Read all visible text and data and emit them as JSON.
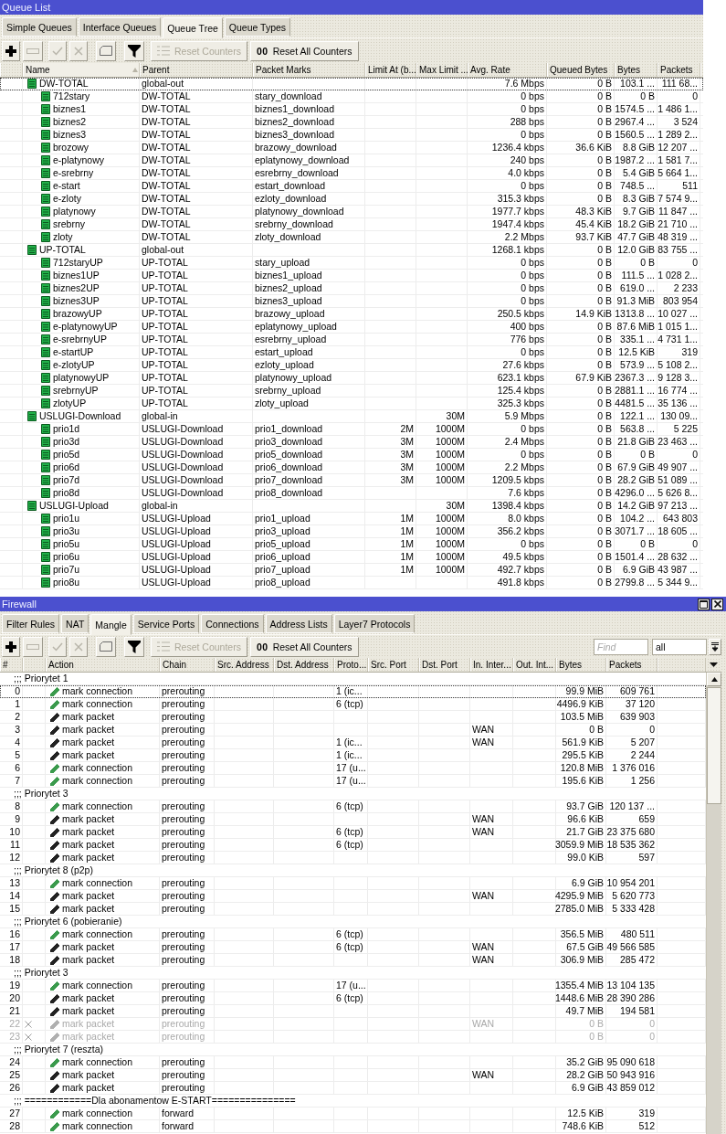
{
  "queue_list": {
    "title": "Queue List",
    "tabs": [
      {
        "label": "Simple Queues",
        "selected": false
      },
      {
        "label": "Interface Queues",
        "selected": false
      },
      {
        "label": "Queue Tree",
        "selected": true
      },
      {
        "label": "Queue Types",
        "selected": false
      }
    ],
    "toolbar": [
      {
        "kind": "add",
        "disabled": false
      },
      {
        "kind": "remove",
        "disabled": true
      },
      {
        "kind": "enable",
        "disabled": true
      },
      {
        "kind": "disable",
        "disabled": true
      },
      {
        "kind": "comment",
        "disabled": false
      },
      {
        "kind": "filter",
        "disabled": false
      },
      {
        "kind": "reset",
        "label": "Reset Counters",
        "disabled": true
      },
      {
        "kind": "reset_all",
        "glyph": "00",
        "label": "Reset All Counters",
        "disabled": false
      }
    ],
    "table": {
      "columns": [
        {
          "label": "Name",
          "sorted": true
        },
        {
          "label": "Parent",
          "sorted": false
        },
        {
          "label": "Packet Marks",
          "sorted": false
        },
        {
          "label": "Limit At (b...",
          "sorted": false
        },
        {
          "label": "Max Limit ...",
          "sorted": false
        },
        {
          "label": "Avg. Rate",
          "sorted": false
        },
        {
          "label": "Queued Bytes",
          "sorted": false
        },
        {
          "label": "Bytes",
          "sorted": false
        },
        {
          "label": "Packets",
          "sorted": false
        }
      ],
      "rows": [
        {
          "name": "DW-TOTAL",
          "parent": "global-out",
          "avg_rate": "7.6 Mbps",
          "queued_bytes": "0 B",
          "bytes": "103.1 ...",
          "packets": "111 68...",
          "selected": true,
          "children": [
            {
              "name": "712stary",
              "parent": "DW-TOTAL",
              "packet_marks": "stary_download",
              "avg_rate": "0 bps",
              "queued_bytes": "0 B",
              "bytes": "0 B",
              "packets": "0",
              "selected": false
            },
            {
              "name": "biznes1",
              "parent": "DW-TOTAL",
              "packet_marks": "biznes1_download",
              "avg_rate": "0 bps",
              "queued_bytes": "0 B",
              "bytes": "1574.5 ...",
              "packets": "1 486 1...",
              "selected": false
            },
            {
              "name": "biznes2",
              "parent": "DW-TOTAL",
              "packet_marks": "biznes2_download",
              "avg_rate": "288 bps",
              "queued_bytes": "0 B",
              "bytes": "2967.4 ...",
              "packets": "3 524",
              "selected": false
            },
            {
              "name": "biznes3",
              "parent": "DW-TOTAL",
              "packet_marks": "biznes3_download",
              "avg_rate": "0 bps",
              "queued_bytes": "0 B",
              "bytes": "1560.5 ...",
              "packets": "1 289 2...",
              "selected": false
            },
            {
              "name": "brozowy",
              "parent": "DW-TOTAL",
              "packet_marks": "brazowy_download",
              "avg_rate": "1236.4 kbps",
              "queued_bytes": "36.6 KiB",
              "bytes": "8.8 GiB",
              "packets": "12 207 ...",
              "selected": false
            },
            {
              "name": "e-platynowy",
              "parent": "DW-TOTAL",
              "packet_marks": "eplatynowy_download",
              "avg_rate": "240 bps",
              "queued_bytes": "0 B",
              "bytes": "1987.2 ...",
              "packets": "1 581 7...",
              "selected": false
            },
            {
              "name": "e-srebrny",
              "parent": "DW-TOTAL",
              "packet_marks": "esrebrny_download",
              "avg_rate": "4.0 kbps",
              "queued_bytes": "0 B",
              "bytes": "5.4 GiB",
              "packets": "5 664 1...",
              "selected": false
            },
            {
              "name": "e-start",
              "parent": "DW-TOTAL",
              "packet_marks": "estart_download",
              "avg_rate": "0 bps",
              "queued_bytes": "0 B",
              "bytes": "748.5 ...",
              "packets": "511",
              "selected": false
            },
            {
              "name": "e-zloty",
              "parent": "DW-TOTAL",
              "packet_marks": "ezloty_download",
              "avg_rate": "315.3 kbps",
              "queued_bytes": "0 B",
              "bytes": "8.3 GiB",
              "packets": "7 574 9...",
              "selected": false
            },
            {
              "name": "platynowy",
              "parent": "DW-TOTAL",
              "packet_marks": "platynowy_download",
              "avg_rate": "1977.7 kbps",
              "queued_bytes": "48.3 KiB",
              "bytes": "9.7 GiB",
              "packets": "11 847 ...",
              "selected": false
            },
            {
              "name": "srebrny",
              "parent": "DW-TOTAL",
              "packet_marks": "srebrny_download",
              "avg_rate": "1947.4 kbps",
              "queued_bytes": "45.4 KiB",
              "bytes": "18.2 GiB",
              "packets": "21 710 ...",
              "selected": false
            },
            {
              "name": "zloty",
              "parent": "DW-TOTAL",
              "packet_marks": "zloty_download",
              "avg_rate": "2.2 Mbps",
              "queued_bytes": "93.7 KiB",
              "bytes": "47.7 GiB",
              "packets": "48 319 ...",
              "selected": false
            }
          ]
        },
        {
          "name": "UP-TOTAL",
          "parent": "global-out",
          "avg_rate": "1268.1 kbps",
          "queued_bytes": "0 B",
          "bytes": "12.0 GiB",
          "packets": "83 755 ...",
          "selected": false,
          "children": [
            {
              "name": "712staryUP",
              "parent": "UP-TOTAL",
              "packet_marks": "stary_upload",
              "avg_rate": "0 bps",
              "queued_bytes": "0 B",
              "bytes": "0 B",
              "packets": "0",
              "selected": false
            },
            {
              "name": "biznes1UP",
              "parent": "UP-TOTAL",
              "packet_marks": "biznes1_upload",
              "avg_rate": "0 bps",
              "queued_bytes": "0 B",
              "bytes": "111.5 ...",
              "packets": "1 028 2...",
              "selected": false
            },
            {
              "name": "biznes2UP",
              "parent": "UP-TOTAL",
              "packet_marks": "biznes2_upload",
              "avg_rate": "0 bps",
              "queued_bytes": "0 B",
              "bytes": "619.0 ...",
              "packets": "2 233",
              "selected": false
            },
            {
              "name": "biznes3UP",
              "parent": "UP-TOTAL",
              "packet_marks": "biznes3_upload",
              "avg_rate": "0 bps",
              "queued_bytes": "0 B",
              "bytes": "91.3 MiB",
              "packets": "803 954",
              "selected": false
            },
            {
              "name": "brazowyUP",
              "parent": "UP-TOTAL",
              "packet_marks": "brazowy_upload",
              "avg_rate": "250.5 kbps",
              "queued_bytes": "14.9 KiB",
              "bytes": "1313.8 ...",
              "packets": "10 027 ...",
              "selected": false
            },
            {
              "name": "e-platynowyUP",
              "parent": "UP-TOTAL",
              "packet_marks": "eplatynowy_upload",
              "avg_rate": "400 bps",
              "queued_bytes": "0 B",
              "bytes": "87.6 MiB",
              "packets": "1 015 1...",
              "selected": false
            },
            {
              "name": "e-srebrnyUP",
              "parent": "UP-TOTAL",
              "packet_marks": "esrebrny_upload",
              "avg_rate": "776 bps",
              "queued_bytes": "0 B",
              "bytes": "335.1 ...",
              "packets": "4 731 1...",
              "selected": false
            },
            {
              "name": "e-startUP",
              "parent": "UP-TOTAL",
              "packet_marks": "estart_upload",
              "avg_rate": "0 bps",
              "queued_bytes": "0 B",
              "bytes": "12.5 KiB",
              "packets": "319",
              "selected": false
            },
            {
              "name": "e-zlotyUP",
              "parent": "UP-TOTAL",
              "packet_marks": "ezloty_upload",
              "avg_rate": "27.6 kbps",
              "queued_bytes": "0 B",
              "bytes": "573.9 ...",
              "packets": "5 108 2...",
              "selected": false
            },
            {
              "name": "platynowyUP",
              "parent": "UP-TOTAL",
              "packet_marks": "platynowy_upload",
              "avg_rate": "623.1 kbps",
              "queued_bytes": "67.9 KiB",
              "bytes": "2367.3 ...",
              "packets": "9 128 3...",
              "selected": false
            },
            {
              "name": "srebrnyUP",
              "parent": "UP-TOTAL",
              "packet_marks": "srebrny_upload",
              "avg_rate": "125.4 kbps",
              "queued_bytes": "0 B",
              "bytes": "2881.1 ...",
              "packets": "16 774 ...",
              "selected": false
            },
            {
              "name": "zlotyUP",
              "parent": "UP-TOTAL",
              "packet_marks": "zloty_upload",
              "avg_rate": "325.3 kbps",
              "queued_bytes": "0 B",
              "bytes": "4481.5 ...",
              "packets": "35 136 ...",
              "selected": false
            }
          ]
        },
        {
          "name": "USLUGI-Download",
          "parent": "global-in",
          "max_limit": "30M",
          "avg_rate": "5.9 Mbps",
          "queued_bytes": "0 B",
          "bytes": "122.1 ...",
          "packets": "130 09...",
          "selected": false,
          "children": [
            {
              "name": "prio1d",
              "parent": "USLUGI-Download",
              "packet_marks": "prio1_download",
              "limit_at": "2M",
              "max_limit": "1000M",
              "avg_rate": "0 bps",
              "queued_bytes": "0 B",
              "bytes": "563.8 ...",
              "packets": "5 225",
              "selected": false
            },
            {
              "name": "prio3d",
              "parent": "USLUGI-Download",
              "packet_marks": "prio3_download",
              "limit_at": "3M",
              "max_limit": "1000M",
              "avg_rate": "2.4 Mbps",
              "queued_bytes": "0 B",
              "bytes": "21.8 GiB",
              "packets": "23 463 ...",
              "selected": false
            },
            {
              "name": "prio5d",
              "parent": "USLUGI-Download",
              "packet_marks": "prio5_download",
              "limit_at": "3M",
              "max_limit": "1000M",
              "avg_rate": "0 bps",
              "queued_bytes": "0 B",
              "bytes": "0 B",
              "packets": "0",
              "selected": false
            },
            {
              "name": "prio6d",
              "parent": "USLUGI-Download",
              "packet_marks": "prio6_download",
              "limit_at": "3M",
              "max_limit": "1000M",
              "avg_rate": "2.2 Mbps",
              "queued_bytes": "0 B",
              "bytes": "67.9 GiB",
              "packets": "49 907 ...",
              "selected": false
            },
            {
              "name": "prio7d",
              "parent": "USLUGI-Download",
              "packet_marks": "prio7_download",
              "limit_at": "3M",
              "max_limit": "1000M",
              "avg_rate": "1209.5 kbps",
              "queued_bytes": "0 B",
              "bytes": "28.2 GiB",
              "packets": "51 089 ...",
              "selected": false
            },
            {
              "name": "prio8d",
              "parent": "USLUGI-Download",
              "packet_marks": "prio8_download",
              "avg_rate": "7.6 kbps",
              "queued_bytes": "0 B",
              "bytes": "4296.0 ...",
              "packets": "5 626 8...",
              "selected": false
            }
          ]
        },
        {
          "name": "USLUGI-Upload",
          "parent": "global-in",
          "max_limit": "30M",
          "avg_rate": "1398.4 kbps",
          "queued_bytes": "0 B",
          "bytes": "14.2 GiB",
          "packets": "97 213 ...",
          "selected": false,
          "children": [
            {
              "name": "prio1u",
              "parent": "USLUGI-Upload",
              "packet_marks": "prio1_upload",
              "limit_at": "1M",
              "max_limit": "1000M",
              "avg_rate": "8.0 kbps",
              "queued_bytes": "0 B",
              "bytes": "104.2 ...",
              "packets": "643 803",
              "selected": false
            },
            {
              "name": "prio3u",
              "parent": "USLUGI-Upload",
              "packet_marks": "prio3_upload",
              "limit_at": "1M",
              "max_limit": "1000M",
              "avg_rate": "356.2 kbps",
              "queued_bytes": "0 B",
              "bytes": "3071.7 ...",
              "packets": "18 605 ...",
              "selected": false
            },
            {
              "name": "prio5u",
              "parent": "USLUGI-Upload",
              "packet_marks": "prio5_upload",
              "limit_at": "1M",
              "max_limit": "1000M",
              "avg_rate": "0 bps",
              "queued_bytes": "0 B",
              "bytes": "0 B",
              "packets": "0",
              "selected": false
            },
            {
              "name": "prio6u",
              "parent": "USLUGI-Upload",
              "packet_marks": "prio6_upload",
              "limit_at": "1M",
              "max_limit": "1000M",
              "avg_rate": "49.5 kbps",
              "queued_bytes": "0 B",
              "bytes": "1501.4 ...",
              "packets": "28 632 ...",
              "selected": false
            },
            {
              "name": "prio7u",
              "parent": "USLUGI-Upload",
              "packet_marks": "prio7_upload",
              "limit_at": "1M",
              "max_limit": "1000M",
              "avg_rate": "492.7 kbps",
              "queued_bytes": "0 B",
              "bytes": "6.9 GiB",
              "packets": "43 987 ...",
              "selected": false
            },
            {
              "name": "prio8u",
              "parent": "USLUGI-Upload",
              "packet_marks": "prio8_upload",
              "avg_rate": "491.8 kbps",
              "queued_bytes": "0 B",
              "bytes": "2799.8 ...",
              "packets": "5 344 9...",
              "selected": false
            }
          ]
        }
      ]
    }
  },
  "firewall": {
    "title": "Firewall",
    "tabs": [
      {
        "label": "Filter Rules",
        "selected": false
      },
      {
        "label": "NAT",
        "selected": false
      },
      {
        "label": "Mangle",
        "selected": true
      },
      {
        "label": "Service Ports",
        "selected": false
      },
      {
        "label": "Connections",
        "selected": false
      },
      {
        "label": "Address Lists",
        "selected": false
      },
      {
        "label": "Layer7 Protocols",
        "selected": false
      }
    ],
    "toolbar": [
      {
        "kind": "add",
        "disabled": false
      },
      {
        "kind": "remove",
        "disabled": true
      },
      {
        "kind": "enable",
        "disabled": true
      },
      {
        "kind": "disable",
        "disabled": true
      },
      {
        "kind": "comment",
        "disabled": false
      },
      {
        "kind": "filter",
        "disabled": false
      },
      {
        "kind": "reset",
        "label": "Reset Counters",
        "disabled": true
      },
      {
        "kind": "reset_all",
        "glyph": "00",
        "label": "Reset All Counters",
        "disabled": false
      }
    ],
    "find_field": {
      "placeholder": "Find"
    },
    "filter_dropdown": {
      "value": "all"
    },
    "table": {
      "columns": [
        "#",
        "Action",
        "Chain",
        "Src. Address",
        "Dst. Address",
        "Proto...",
        "Src. Port",
        "Dst. Port",
        "In. Inter...",
        "Out. Int...",
        "Bytes",
        "Packets"
      ],
      "rows": [
        {
          "kind": "comment",
          "text": ";;; Priorytet 1",
          "selected": false
        },
        {
          "kind": "rule",
          "number": "0",
          "action": "mark connection",
          "color": "#3a9a4c",
          "chain": "prerouting",
          "protocol": "1 (ic...",
          "bytes": "99.9 MiB",
          "packets": "609 761",
          "disabled": false,
          "selected": true
        },
        {
          "kind": "rule",
          "number": "1",
          "action": "mark connection",
          "color": "#3a9a4c",
          "chain": "prerouting",
          "protocol": "6 (tcp)",
          "bytes": "4496.9 KiB",
          "packets": "37 120",
          "disabled": false,
          "selected": false
        },
        {
          "kind": "rule",
          "number": "2",
          "action": "mark packet",
          "color": "#222222",
          "chain": "prerouting",
          "bytes": "103.5 MiB",
          "packets": "639 903",
          "disabled": false,
          "selected": false
        },
        {
          "kind": "rule",
          "number": "3",
          "action": "mark packet",
          "color": "#222222",
          "chain": "prerouting",
          "in_interface": "WAN",
          "bytes": "0 B",
          "packets": "0",
          "disabled": false,
          "selected": false
        },
        {
          "kind": "rule",
          "number": "4",
          "action": "mark packet",
          "color": "#222222",
          "chain": "prerouting",
          "protocol": "1 (ic...",
          "in_interface": "WAN",
          "bytes": "561.9 KiB",
          "packets": "5 207",
          "disabled": false,
          "selected": false
        },
        {
          "kind": "rule",
          "number": "5",
          "action": "mark packet",
          "color": "#222222",
          "chain": "prerouting",
          "protocol": "1 (ic...",
          "bytes": "295.5 KiB",
          "packets": "2 244",
          "disabled": false,
          "selected": false
        },
        {
          "kind": "rule",
          "number": "6",
          "action": "mark connection",
          "color": "#3a9a4c",
          "chain": "prerouting",
          "protocol": "17 (u...",
          "bytes": "120.8 MiB",
          "packets": "1 376 016",
          "disabled": false,
          "selected": false
        },
        {
          "kind": "rule",
          "number": "7",
          "action": "mark connection",
          "color": "#3a9a4c",
          "chain": "prerouting",
          "protocol": "17 (u...",
          "bytes": "195.6 KiB",
          "packets": "1 256",
          "disabled": false,
          "selected": false
        },
        {
          "kind": "comment",
          "text": ";;; Priorytet 3",
          "selected": false
        },
        {
          "kind": "rule",
          "number": "8",
          "action": "mark connection",
          "color": "#3a9a4c",
          "chain": "prerouting",
          "protocol": "6 (tcp)",
          "bytes": "93.7 GiB",
          "packets": "120 137 ...",
          "disabled": false,
          "selected": false
        },
        {
          "kind": "rule",
          "number": "9",
          "action": "mark packet",
          "color": "#222222",
          "chain": "prerouting",
          "in_interface": "WAN",
          "bytes": "96.6 KiB",
          "packets": "659",
          "disabled": false,
          "selected": false
        },
        {
          "kind": "rule",
          "number": "10",
          "action": "mark packet",
          "color": "#222222",
          "chain": "prerouting",
          "protocol": "6 (tcp)",
          "in_interface": "WAN",
          "bytes": "21.7 GiB",
          "packets": "23 375 680",
          "disabled": false,
          "selected": false
        },
        {
          "kind": "rule",
          "number": "11",
          "action": "mark packet",
          "color": "#222222",
          "chain": "prerouting",
          "protocol": "6 (tcp)",
          "bytes": "3059.9 MiB",
          "packets": "18 535 362",
          "disabled": false,
          "selected": false
        },
        {
          "kind": "rule",
          "number": "12",
          "action": "mark packet",
          "color": "#222222",
          "chain": "prerouting",
          "bytes": "99.0 KiB",
          "packets": "597",
          "disabled": false,
          "selected": false
        },
        {
          "kind": "comment",
          "text": ";;; Priorytet 8 (p2p)",
          "selected": false
        },
        {
          "kind": "rule",
          "number": "13",
          "action": "mark connection",
          "color": "#3a9a4c",
          "chain": "prerouting",
          "bytes": "6.9 GiB",
          "packets": "10 954 201",
          "disabled": false,
          "selected": false
        },
        {
          "kind": "rule",
          "number": "14",
          "action": "mark packet",
          "color": "#222222",
          "chain": "prerouting",
          "in_interface": "WAN",
          "bytes": "4295.9 MiB",
          "packets": "5 620 773",
          "disabled": false,
          "selected": false
        },
        {
          "kind": "rule",
          "number": "15",
          "action": "mark packet",
          "color": "#222222",
          "chain": "prerouting",
          "bytes": "2785.0 MiB",
          "packets": "5 333 428",
          "disabled": false,
          "selected": false
        },
        {
          "kind": "comment",
          "text": ";;; Priorytet 6 (pobieranie)",
          "selected": false
        },
        {
          "kind": "rule",
          "number": "16",
          "action": "mark connection",
          "color": "#3a9a4c",
          "chain": "prerouting",
          "protocol": "6 (tcp)",
          "bytes": "356.5 MiB",
          "packets": "480 511",
          "disabled": false,
          "selected": false
        },
        {
          "kind": "rule",
          "number": "17",
          "action": "mark packet",
          "color": "#222222",
          "chain": "prerouting",
          "protocol": "6 (tcp)",
          "in_interface": "WAN",
          "bytes": "67.5 GiB",
          "packets": "49 566 585",
          "disabled": false,
          "selected": false
        },
        {
          "kind": "rule",
          "number": "18",
          "action": "mark packet",
          "color": "#222222",
          "chain": "prerouting",
          "in_interface": "WAN",
          "bytes": "306.9 MiB",
          "packets": "285 472",
          "disabled": false,
          "selected": false
        },
        {
          "kind": "comment",
          "text": ";;; Priorytet 3",
          "selected": false
        },
        {
          "kind": "rule",
          "number": "19",
          "action": "mark connection",
          "color": "#3a9a4c",
          "chain": "prerouting",
          "protocol": "17 (u...",
          "bytes": "1355.4 MiB",
          "packets": "13 104 135",
          "disabled": false,
          "selected": false
        },
        {
          "kind": "rule",
          "number": "20",
          "action": "mark packet",
          "color": "#222222",
          "chain": "prerouting",
          "protocol": "6 (tcp)",
          "bytes": "1448.6 MiB",
          "packets": "28 390 286",
          "disabled": false,
          "selected": false
        },
        {
          "kind": "rule",
          "number": "21",
          "action": "mark packet",
          "color": "#222222",
          "chain": "prerouting",
          "bytes": "49.7 MiB",
          "packets": "194 581",
          "disabled": false,
          "selected": false
        },
        {
          "kind": "rule",
          "number": "22",
          "action": "mark packet",
          "color": "#b0b0b0",
          "chain": "prerouting",
          "in_interface": "WAN",
          "bytes": "0 B",
          "packets": "0",
          "disabled": true,
          "selected": false
        },
        {
          "kind": "rule",
          "number": "23",
          "action": "mark packet",
          "color": "#b0b0b0",
          "chain": "prerouting",
          "bytes": "0 B",
          "packets": "0",
          "disabled": true,
          "selected": false
        },
        {
          "kind": "comment",
          "text": ";;; Priorytet 7 (reszta)",
          "selected": false
        },
        {
          "kind": "rule",
          "number": "24",
          "action": "mark connection",
          "color": "#3a9a4c",
          "chain": "prerouting",
          "bytes": "35.2 GiB",
          "packets": "95 090 618",
          "disabled": false,
          "selected": false
        },
        {
          "kind": "rule",
          "number": "25",
          "action": "mark packet",
          "color": "#222222",
          "chain": "prerouting",
          "in_interface": "WAN",
          "bytes": "28.2 GiB",
          "packets": "50 943 916",
          "disabled": false,
          "selected": false
        },
        {
          "kind": "rule",
          "number": "26",
          "action": "mark packet",
          "color": "#222222",
          "chain": "prerouting",
          "bytes": "6.9 GiB",
          "packets": "43 859 012",
          "disabled": false,
          "selected": false
        },
        {
          "kind": "comment",
          "text": ";;; ============Dla abonamentow E-START===============",
          "selected": false
        },
        {
          "kind": "rule",
          "number": "27",
          "action": "mark connection",
          "color": "#3a9a4c",
          "chain": "forward",
          "bytes": "12.5 KiB",
          "packets": "319",
          "disabled": false,
          "selected": false
        },
        {
          "kind": "rule",
          "number": "28",
          "action": "mark connection",
          "color": "#3a9a4c",
          "chain": "forward",
          "bytes": "748.6 KiB",
          "packets": "512",
          "disabled": false,
          "selected": false
        }
      ]
    }
  }
}
